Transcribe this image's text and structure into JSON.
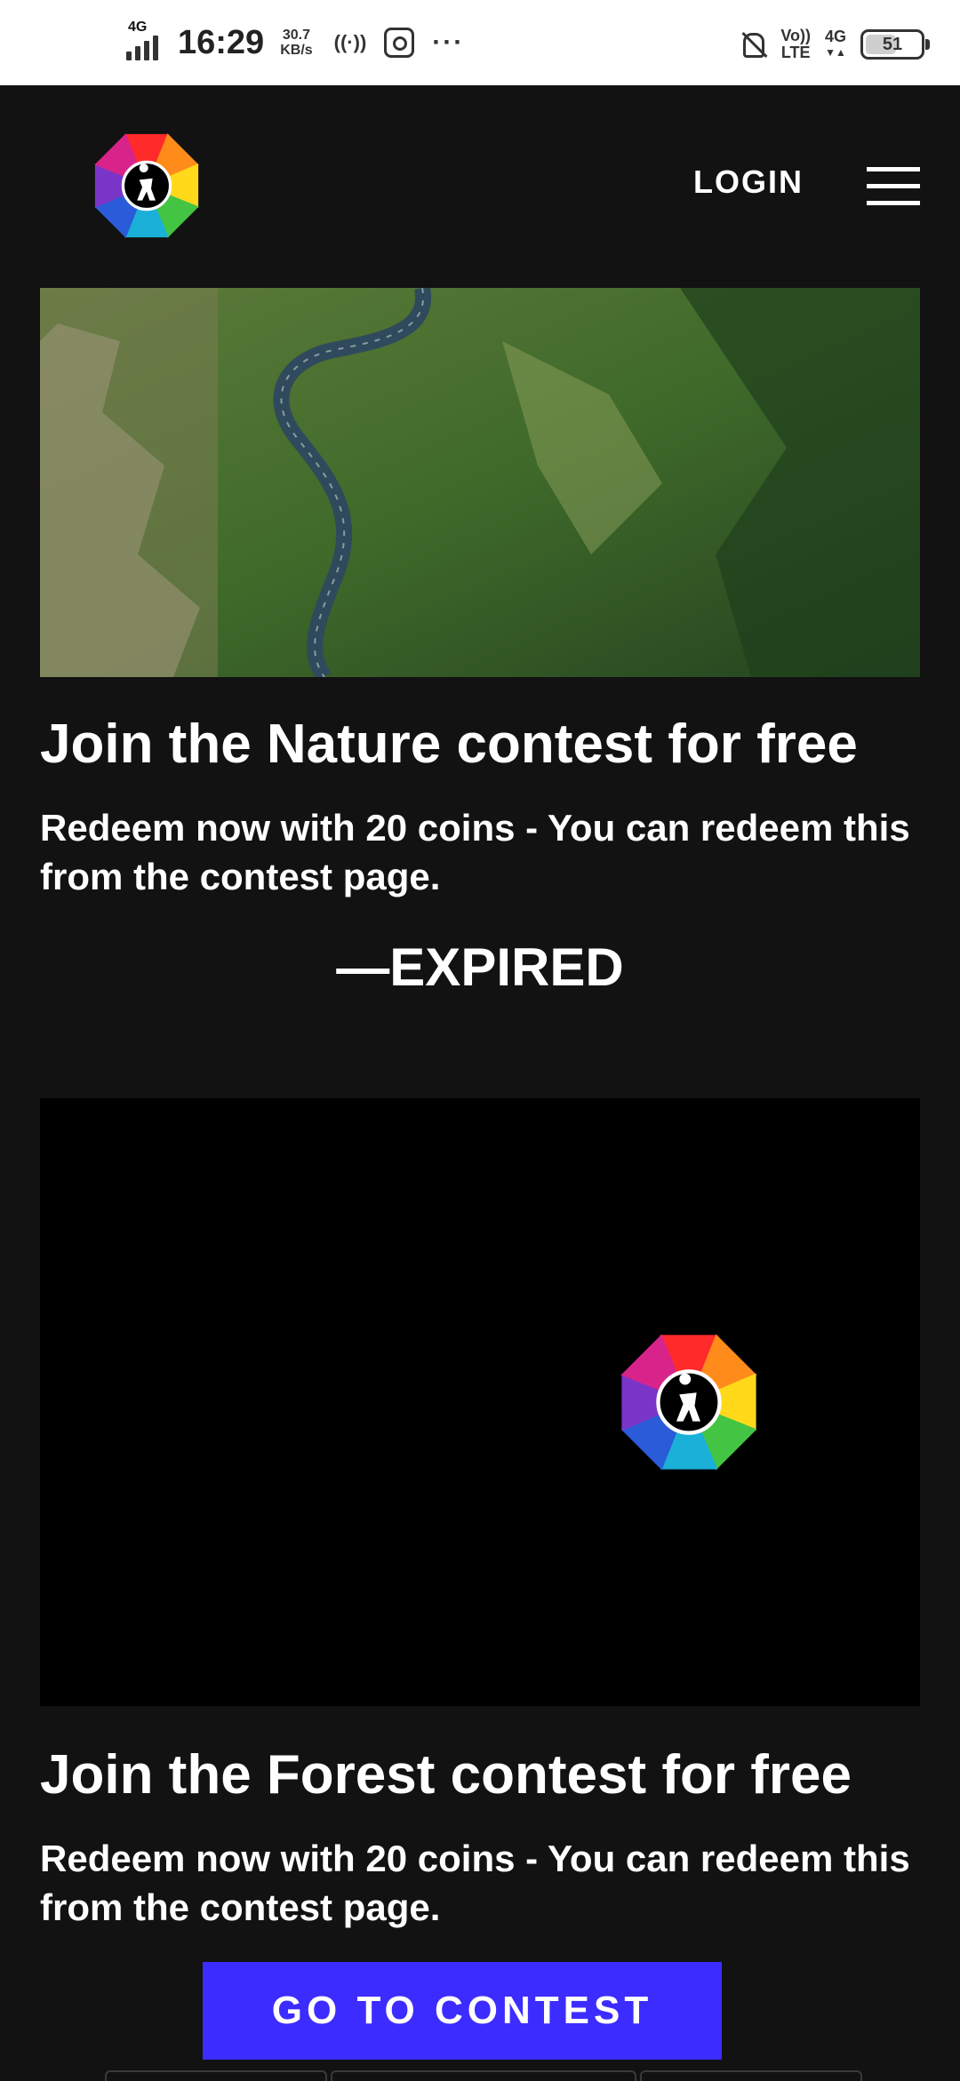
{
  "status_bar": {
    "network_tag": "4G",
    "time": "16:29",
    "speed_value": "30.7",
    "speed_unit": "KB/s",
    "hotspot_icon": "hotspot-icon",
    "more": "···",
    "volte_top": "Vo))",
    "volte_bottom": "LTE",
    "net_right": "4G",
    "battery": "51"
  },
  "header": {
    "logo": "flower-camera-logo",
    "login_label": "LOGIN",
    "menu_icon": "hamburger-menu-icon"
  },
  "contests": [
    {
      "title": "Join the Nature contest for free",
      "description": "Redeem now with 20 coins - You can redeem this from the contest page.",
      "status": "—EXPIRED"
    },
    {
      "title": "Join the Forest contest for free",
      "description": "Redeem now with 20 coins - You can redeem this from the contest page.",
      "button_label": "GO TO CONTEST"
    }
  ],
  "colors": {
    "background": "#121212",
    "cta": "#3d2cff",
    "text": "#ffffff"
  }
}
